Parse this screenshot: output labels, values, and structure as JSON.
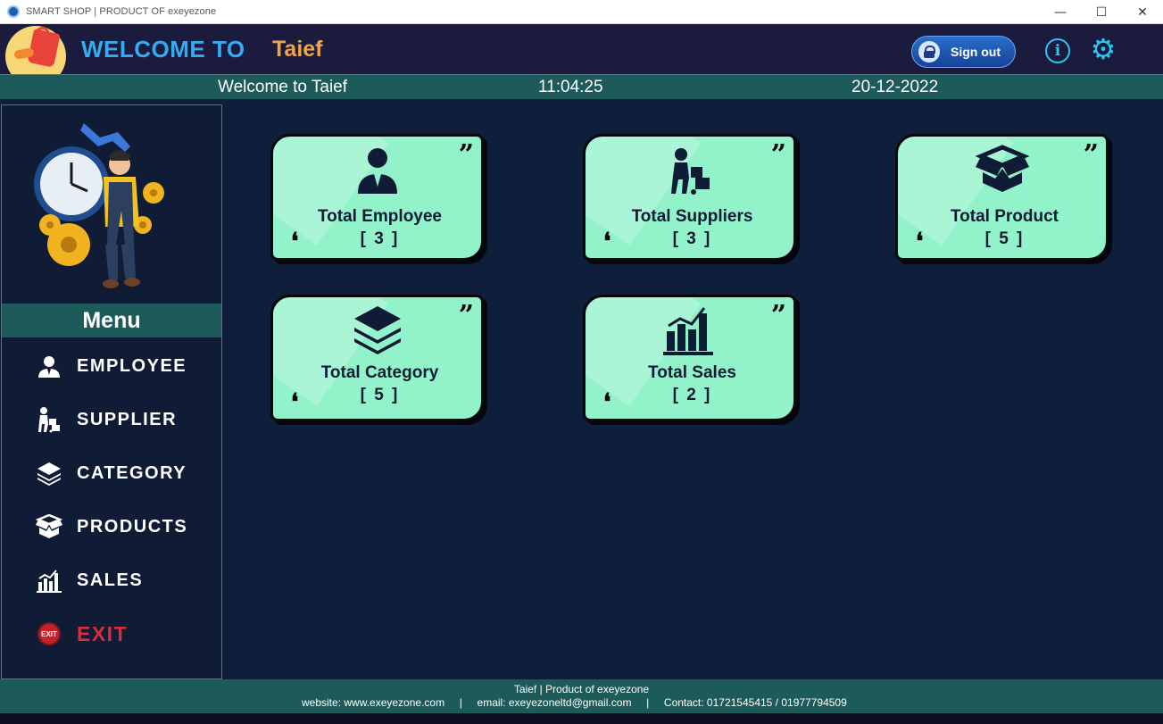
{
  "window": {
    "title": "SMART SHOP | PRODUCT OF exeyezone",
    "minimize": "—",
    "maximize": "☐",
    "close": "✕"
  },
  "header": {
    "welcome": "WELCOME TO",
    "username": "Taief",
    "signout_label": "Sign out",
    "info_icon": "i",
    "settings_icon": "⚙"
  },
  "infobar": {
    "greeting": "Welcome to Taief",
    "time": "11:04:25",
    "date": "20-12-2022"
  },
  "sidebar": {
    "menu_title": "Menu",
    "items": [
      {
        "label": "EMPLOYEE",
        "icon": "employee-icon"
      },
      {
        "label": "SUPPLIER",
        "icon": "supplier-icon"
      },
      {
        "label": "CATEGORY",
        "icon": "category-icon"
      },
      {
        "label": "PRODUCTS",
        "icon": "products-icon"
      },
      {
        "label": "SALES",
        "icon": "sales-icon"
      },
      {
        "label": "EXIT",
        "icon": "exit-icon",
        "badge": "EXIT"
      }
    ]
  },
  "cards": [
    {
      "title": "Total Employee",
      "count": "[ 3 ]",
      "icon": "employee-icon"
    },
    {
      "title": "Total Suppliers",
      "count": "[ 3 ]",
      "icon": "supplier-icon"
    },
    {
      "title": "Total Product",
      "count": "[ 5 ]",
      "icon": "box-icon"
    },
    {
      "title": "Total Category",
      "count": "[ 5 ]",
      "icon": "layers-icon"
    },
    {
      "title": "Total Sales",
      "count": "[ 2 ]",
      "icon": "bar-chart-icon"
    }
  ],
  "quote": {
    "open": "❛",
    "close": "”"
  },
  "footer": {
    "line1": "Taief | Product of exeyezone",
    "line2": "website: www.exeyezone.com     |     email: exeyezoneltd@gmail.com     |     Contact: 01721545415 / 01977794509"
  },
  "colors": {
    "background": "#0f1e3b",
    "header": "#1b1c3d",
    "teal_bar": "#1d5a5a",
    "card": "#92f2c9",
    "accent_blue": "#37a9f0",
    "accent_orange": "#f3a24a",
    "exit_red": "#d92d3a"
  }
}
